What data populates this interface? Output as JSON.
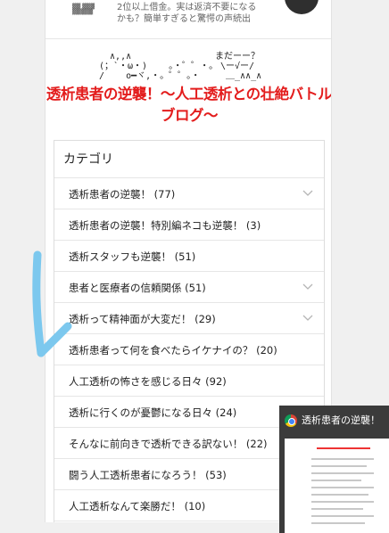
{
  "ad": {
    "thumb_text": "▓▓ ▓▓▓\n▓▓▓▓▓",
    "line1": "2位以上借金。実は返済不要になる",
    "line2": "かも？簡単すぎると驚愕の声続出"
  },
  "banner": {
    "aa_left": "  ∧,,∧\n(；`・ω・)    。・゜゜・。\n/    ο━ヾ,・。゜゜。・",
    "aa_right": "まだーー？\n \\ー√ー/\n  ＿_∧∧_∧",
    "title": "透析患者の逆襲！～人工透析との壮絶バトルブログ～"
  },
  "categories": {
    "heading": "カテゴリ",
    "items": [
      {
        "label": "透析患者の逆襲！ (77)",
        "expandable": true
      },
      {
        "label": "透析患者の逆襲！特別編ネコも逆襲！ (3)",
        "expandable": false
      },
      {
        "label": "透析スタッフも逆襲！ (51)",
        "expandable": false
      },
      {
        "label": "患者と医療者の信頼関係 (51)",
        "expandable": true
      },
      {
        "label": "透析って精神面が大変だ！ (29)",
        "expandable": true
      },
      {
        "label": "透析患者って何を食べたらイケナイの？ (20)",
        "expandable": false
      },
      {
        "label": "人工透析の怖さを感じる日々 (92)",
        "expandable": false
      },
      {
        "label": "透析に行くのが憂鬱になる日々 (24)",
        "expandable": false
      },
      {
        "label": "そんなに前向きで透析できる訳ない！ (22)",
        "expandable": false
      },
      {
        "label": "闘う人工透析患者になろう！ (53)",
        "expandable": false
      },
      {
        "label": "人工透析なんて楽勝だ！ (10)",
        "expandable": false
      }
    ]
  },
  "popup": {
    "title": "透析患者の逆襲！"
  },
  "colors": {
    "title_red": "#e31d1d",
    "arrow_blue": "#7cc8ee",
    "popup_bg": "#3b3b3b"
  }
}
